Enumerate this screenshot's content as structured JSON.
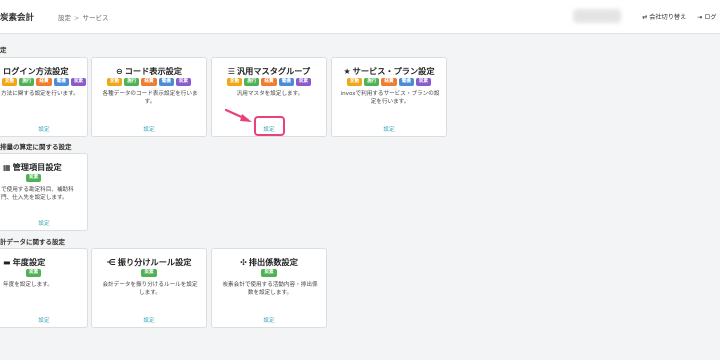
{
  "header": {
    "app_title": "炭素会計",
    "breadcrumb": [
      "設定",
      "サービス"
    ],
    "breadcrumb_sep": ">",
    "switch_company": "会社切り替え",
    "logout": "ログ"
  },
  "sections": [
    {
      "title": "定"
    },
    {
      "title": "排量の算定に関する設定"
    },
    {
      "title": "計データに関する設定"
    }
  ],
  "badges": {
    "henkan": {
      "label": "変動",
      "color": "#f2a516"
    },
    "shiko": {
      "label": "施行",
      "color": "#4fb356"
    },
    "keihi": {
      "label": "経費",
      "color": "#f27c2b"
    },
    "denki": {
      "label": "電機",
      "color": "#4a8ddb"
    },
    "tanso": {
      "label": "炭素",
      "color": "#8a5ccb"
    },
    "tanso_green": {
      "label": "炭素",
      "color": "#4fb356"
    }
  },
  "cards": {
    "login": {
      "title": "ログイン方法設定",
      "icon": "",
      "desc": "方法に関する設定を行います。",
      "link": "設定"
    },
    "code": {
      "title": "コード表示設定",
      "icon": "code-icon",
      "desc": "各種データのコード表示設定を行います。",
      "link": "設定"
    },
    "master": {
      "title": "汎用マスタグループ",
      "icon": "list-icon",
      "desc": "汎用マスタを設定します。",
      "link": "設定"
    },
    "service": {
      "title": "サービス・プラン設定",
      "icon": "star-icon",
      "desc": "invoxで利用するサービス・プランの設定を行います。",
      "link": "設定"
    },
    "management": {
      "title": "管理項目設定",
      "icon": "sitemap-icon",
      "desc": "で使用する勘定科目、補助科門、仕入先を設定します。",
      "link": "設定"
    },
    "year": {
      "title": "年度設定",
      "icon": "laptop-icon",
      "desc": "年度を設定します。",
      "link": "設定"
    },
    "allocation": {
      "title": "振り分けルール設定",
      "icon": "split-icon",
      "desc": "会計データを振り分けるルールを設定します。",
      "link": "設定"
    },
    "emission": {
      "title": "排出係数設定",
      "icon": "grid-icon",
      "desc": "炭素会計で使用する活動内容・排出係数を設定します。",
      "link": "設定"
    }
  },
  "colors": {
    "accent": "#3aa7b5",
    "highlight": "#e8417b"
  }
}
